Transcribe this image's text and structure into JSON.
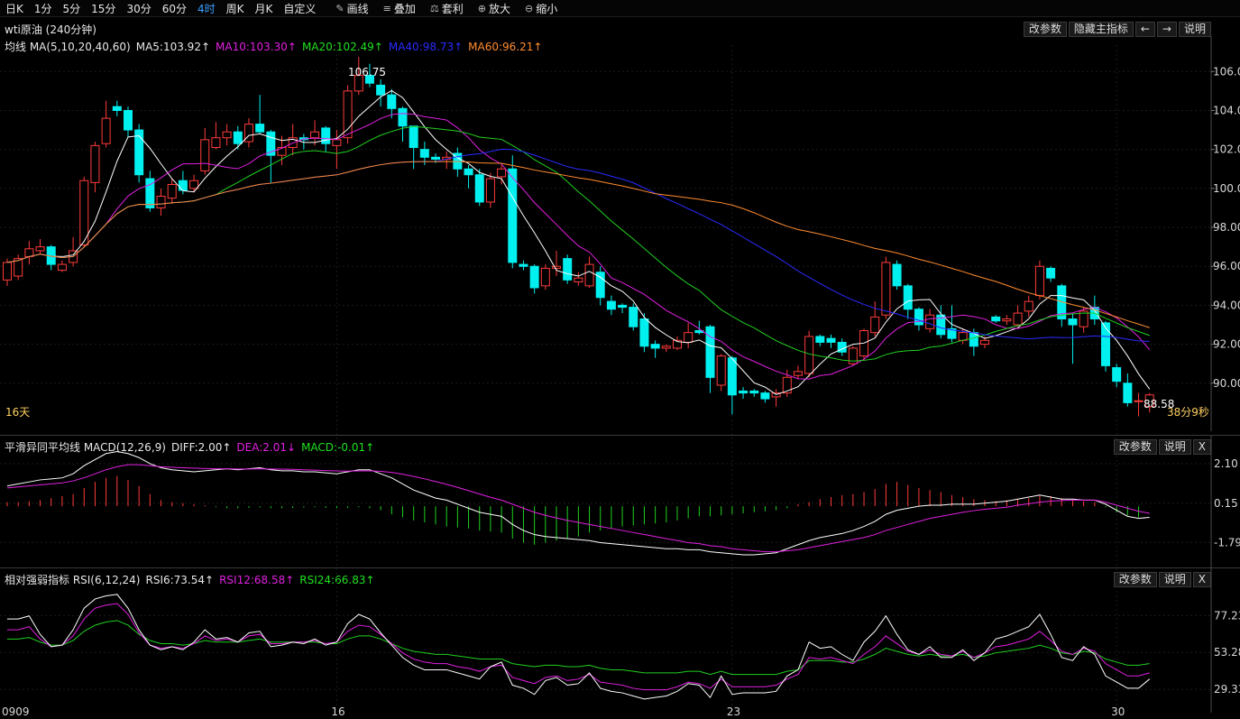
{
  "toolbar": {
    "periods": [
      {
        "label": "日K",
        "active": false
      },
      {
        "label": "1分",
        "active": false
      },
      {
        "label": "5分",
        "active": false
      },
      {
        "label": "15分",
        "active": false
      },
      {
        "label": "30分",
        "active": false
      },
      {
        "label": "60分",
        "active": false
      },
      {
        "label": "4时",
        "active": true
      },
      {
        "label": "周K",
        "active": false
      },
      {
        "label": "月K",
        "active": false
      },
      {
        "label": "自定义",
        "active": false
      }
    ],
    "tools": [
      {
        "label": "画线",
        "icon": "pencil-icon"
      },
      {
        "label": "叠加",
        "icon": "stack-icon"
      },
      {
        "label": "套利",
        "icon": "arbitrage-icon"
      },
      {
        "label": "放大",
        "icon": "zoom-in-icon"
      },
      {
        "label": "缩小",
        "icon": "zoom-out-icon"
      }
    ]
  },
  "main": {
    "title": "wti原油 (240分钟)",
    "buttons": [
      "改参数",
      "隐藏主指标",
      "←",
      "→",
      "说明"
    ],
    "ma_label": "均线 MA(5,10,20,40,60)",
    "ma_items": [
      {
        "text": "MA5:103.92↑",
        "color": "#e8e8e8"
      },
      {
        "text": "MA10:103.30↑",
        "color": "#e020e0"
      },
      {
        "text": "MA20:102.49↑",
        "color": "#20e020"
      },
      {
        "text": "MA40:98.73↑",
        "color": "#2a2aff"
      },
      {
        "text": "MA60:96.21↑",
        "color": "#ff8c30"
      }
    ],
    "high_label": "106.75",
    "last_price": "88.58",
    "countdown": "38分9秒",
    "range_label": "16天",
    "y_ticks": [
      "106.0",
      "104.0",
      "102.0",
      "100.0",
      "98.00",
      "96.00",
      "94.00",
      "92.00",
      "90.00"
    ]
  },
  "macd": {
    "label": "平滑异同平均线 MACD(12,26,9)",
    "items": [
      {
        "text": "DIFF:2.00↑",
        "color": "#e8e8e8"
      },
      {
        "text": "DEA:2.01↓",
        "color": "#e020e0"
      },
      {
        "text": "MACD:-0.01↑",
        "color": "#20e020"
      }
    ],
    "buttons": [
      "改参数",
      "说明",
      "X"
    ],
    "y_ticks": [
      "2.10",
      "0.15",
      "-1.79"
    ]
  },
  "rsi": {
    "label": "相对强弱指标 RSI(6,12,24)",
    "items": [
      {
        "text": "RSI6:73.54↑",
        "color": "#e8e8e8"
      },
      {
        "text": "RSI12:68.58↑",
        "color": "#e020e0"
      },
      {
        "text": "RSI24:66.83↑",
        "color": "#20e020"
      }
    ],
    "buttons": [
      "改参数",
      "说明",
      "X"
    ],
    "y_ticks": [
      "77.23",
      "53.28",
      "29.33"
    ]
  },
  "x_labels": [
    "0909",
    "16",
    "23",
    "30"
  ],
  "colors": {
    "up": "#ff3b3b",
    "down": "#00f0f0",
    "ma5": "#ffffff",
    "ma10": "#e020e0",
    "ma20": "#20d020",
    "ma40": "#2a2aff",
    "ma60": "#ff8c30"
  },
  "chart_data": {
    "type": "candlestick",
    "ylim": [
      88.0,
      106.8
    ],
    "candles": [
      [
        95.3,
        96.2,
        95.0,
        96.4
      ],
      [
        95.5,
        96.4,
        95.3,
        96.6
      ],
      [
        96.5,
        96.9,
        96.1,
        97.3
      ],
      [
        96.8,
        97.0,
        96.6,
        97.4
      ],
      [
        97.0,
        96.1,
        95.8,
        97.1
      ],
      [
        95.8,
        96.1,
        95.7,
        96.3
      ],
      [
        96.2,
        96.8,
        96.0,
        97.5
      ],
      [
        97.1,
        100.4,
        97.0,
        100.6
      ],
      [
        100.3,
        102.2,
        99.8,
        102.4
      ],
      [
        102.3,
        103.6,
        102.1,
        104.5
      ],
      [
        104.2,
        104.0,
        103.7,
        104.5
      ],
      [
        104.0,
        103.0,
        102.6,
        104.2
      ],
      [
        103.0,
        100.7,
        100.3,
        103.3
      ],
      [
        100.5,
        99.0,
        98.8,
        100.9
      ],
      [
        99.0,
        99.6,
        98.6,
        100.0
      ],
      [
        99.5,
        100.2,
        99.2,
        100.5
      ],
      [
        100.4,
        99.9,
        99.7,
        100.9
      ],
      [
        100.0,
        100.4,
        99.8,
        100.7
      ],
      [
        100.9,
        102.5,
        100.7,
        103.1
      ],
      [
        102.1,
        102.6,
        102.0,
        103.4
      ],
      [
        102.6,
        102.9,
        102.2,
        103.3
      ],
      [
        102.9,
        102.3,
        102.0,
        103.2
      ],
      [
        102.4,
        103.3,
        102.1,
        103.6
      ],
      [
        103.3,
        102.9,
        102.8,
        104.8
      ],
      [
        102.9,
        101.7,
        100.3,
        103.0
      ],
      [
        101.7,
        102.1,
        101.2,
        102.7
      ],
      [
        102.1,
        102.6,
        101.7,
        103.3
      ],
      [
        102.6,
        102.5,
        102.0,
        102.8
      ],
      [
        102.6,
        102.9,
        102.2,
        103.5
      ],
      [
        103.1,
        102.3,
        101.9,
        103.2
      ],
      [
        102.2,
        102.5,
        101.0,
        103.0
      ],
      [
        102.6,
        105.0,
        102.3,
        105.3
      ],
      [
        105.0,
        105.8,
        104.8,
        106.75
      ],
      [
        105.8,
        105.4,
        105.2,
        106.4
      ],
      [
        105.3,
        104.8,
        104.2,
        105.6
      ],
      [
        104.8,
        104.1,
        103.6,
        105.1
      ],
      [
        104.1,
        103.2,
        102.4,
        104.2
      ],
      [
        103.2,
        102.1,
        101.0,
        103.2
      ],
      [
        102.0,
        101.6,
        101.2,
        102.4
      ],
      [
        101.6,
        101.5,
        101.3,
        101.8
      ],
      [
        101.5,
        101.6,
        101.0,
        101.9
      ],
      [
        101.8,
        101.0,
        100.6,
        102.1
      ],
      [
        101.0,
        100.7,
        100.0,
        101.2
      ],
      [
        100.7,
        99.3,
        99.1,
        101.0
      ],
      [
        99.3,
        100.5,
        99.0,
        100.8
      ],
      [
        100.6,
        101.0,
        100.2,
        101.2
      ],
      [
        101.0,
        96.2,
        95.9,
        101.7
      ],
      [
        96.1,
        96.0,
        95.8,
        96.3
      ],
      [
        96.0,
        94.9,
        94.6,
        96.1
      ],
      [
        95.0,
        95.9,
        94.8,
        96.1
      ],
      [
        95.9,
        96.0,
        95.5,
        96.8
      ],
      [
        96.4,
        95.3,
        95.1,
        96.6
      ],
      [
        95.2,
        95.4,
        95.0,
        95.7
      ],
      [
        95.0,
        96.1,
        94.9,
        96.5
      ],
      [
        95.7,
        94.4,
        94.0,
        96.0
      ],
      [
        94.2,
        93.8,
        93.5,
        94.5
      ],
      [
        94.0,
        93.9,
        93.6,
        94.1
      ],
      [
        93.9,
        92.9,
        92.7,
        94.1
      ],
      [
        93.3,
        91.9,
        91.6,
        93.6
      ],
      [
        92.0,
        91.8,
        91.3,
        92.2
      ],
      [
        91.8,
        91.9,
        91.6,
        92.0
      ],
      [
        91.8,
        92.2,
        91.7,
        92.4
      ],
      [
        92.1,
        92.6,
        91.8,
        93.1
      ],
      [
        92.7,
        92.6,
        92.5,
        93.2
      ],
      [
        92.9,
        90.3,
        89.5,
        93.0
      ],
      [
        89.9,
        91.4,
        89.6,
        91.5
      ],
      [
        91.3,
        89.4,
        88.4,
        91.4
      ],
      [
        89.6,
        89.5,
        89.2,
        89.8
      ],
      [
        89.6,
        89.5,
        89.3,
        89.7
      ],
      [
        89.5,
        89.2,
        89.0,
        89.6
      ],
      [
        89.3,
        89.5,
        88.8,
        89.7
      ],
      [
        89.5,
        90.3,
        89.3,
        90.7
      ],
      [
        90.4,
        90.6,
        90.2,
        90.9
      ],
      [
        90.5,
        92.4,
        90.3,
        92.7
      ],
      [
        92.4,
        92.1,
        91.9,
        92.5
      ],
      [
        92.3,
        92.1,
        91.8,
        92.5
      ],
      [
        92.1,
        91.6,
        91.4,
        92.3
      ],
      [
        91.0,
        91.8,
        90.9,
        91.9
      ],
      [
        91.4,
        92.7,
        91.2,
        92.8
      ],
      [
        92.6,
        93.4,
        92.4,
        94.2
      ],
      [
        93.5,
        96.2,
        93.3,
        96.5
      ],
      [
        96.1,
        95.0,
        94.8,
        96.3
      ],
      [
        95.0,
        93.8,
        93.3,
        95.1
      ],
      [
        93.8,
        93.0,
        92.7,
        93.9
      ],
      [
        92.8,
        93.5,
        92.6,
        93.8
      ],
      [
        93.5,
        92.5,
        92.3,
        94.0
      ],
      [
        92.8,
        92.3,
        92.1,
        94.0
      ],
      [
        92.2,
        92.6,
        92.0,
        92.8
      ],
      [
        92.6,
        91.9,
        91.4,
        92.8
      ],
      [
        92.0,
        92.2,
        91.8,
        92.4
      ],
      [
        93.4,
        93.2,
        93.1,
        93.5
      ],
      [
        93.2,
        93.3,
        93.0,
        93.5
      ],
      [
        93.0,
        93.6,
        92.9,
        94.0
      ],
      [
        93.7,
        94.2,
        93.4,
        94.5
      ],
      [
        94.5,
        96.0,
        94.3,
        96.3
      ],
      [
        95.9,
        95.4,
        95.2,
        96.0
      ],
      [
        95.0,
        93.3,
        92.9,
        95.1
      ],
      [
        93.3,
        93.0,
        91.0,
        93.6
      ],
      [
        92.9,
        93.7,
        92.6,
        93.9
      ],
      [
        93.9,
        93.3,
        93.0,
        94.5
      ],
      [
        93.1,
        90.9,
        90.6,
        93.2
      ],
      [
        90.8,
        90.1,
        89.8,
        91.0
      ],
      [
        90.0,
        89.0,
        88.8,
        90.5
      ],
      [
        89.1,
        89.1,
        88.3,
        89.5
      ],
      [
        88.8,
        89.4,
        88.5,
        89.5
      ]
    ],
    "macd_ylim": [
      -2.4,
      2.5
    ],
    "macd_hist": [
      0.2,
      0.2,
      0.25,
      0.3,
      0.4,
      0.5,
      0.6,
      0.9,
      1.2,
      1.4,
      1.5,
      1.3,
      1.0,
      0.6,
      0.3,
      0.2,
      0.15,
      0.1,
      0.05,
      -0.05,
      -0.1,
      -0.1,
      -0.08,
      -0.06,
      -0.1,
      -0.1,
      -0.09,
      -0.06,
      -0.05,
      -0.08,
      -0.1,
      -0.08,
      -0.05,
      -0.1,
      -0.2,
      -0.4,
      -0.55,
      -0.7,
      -0.8,
      -0.9,
      -1.0,
      -1.05,
      -1.1,
      -1.2,
      -1.25,
      -1.3,
      -1.6,
      -1.8,
      -1.9,
      -1.8,
      -1.7,
      -1.6,
      -1.5,
      -1.3,
      -1.2,
      -1.1,
      -1.0,
      -0.95,
      -0.9,
      -0.85,
      -0.8,
      -0.7,
      -0.6,
      -0.5,
      -0.5,
      -0.45,
      -0.4,
      -0.35,
      -0.3,
      -0.25,
      -0.2,
      -0.1,
      0.1,
      0.2,
      0.35,
      0.45,
      0.55,
      0.6,
      0.7,
      0.85,
      1.1,
      1.2,
      1.05,
      0.9,
      0.8,
      0.7,
      0.55,
      0.45,
      0.35,
      0.3,
      0.25,
      0.3,
      0.35,
      0.4,
      0.55,
      0.5,
      0.4,
      0.3,
      0.25,
      0.2,
      -0.05,
      -0.3,
      -0.45,
      -0.55,
      -0.01
    ],
    "diff": [
      1.0,
      1.1,
      1.2,
      1.3,
      1.35,
      1.4,
      1.6,
      2.0,
      2.3,
      2.6,
      2.7,
      2.6,
      2.4,
      2.1,
      1.9,
      1.8,
      1.75,
      1.7,
      1.75,
      1.8,
      1.85,
      1.8,
      1.85,
      1.9,
      1.8,
      1.75,
      1.75,
      1.7,
      1.7,
      1.65,
      1.6,
      1.7,
      1.8,
      1.8,
      1.6,
      1.4,
      1.1,
      0.8,
      0.6,
      0.4,
      0.3,
      0.1,
      -0.1,
      -0.3,
      -0.4,
      -0.5,
      -0.9,
      -1.2,
      -1.4,
      -1.5,
      -1.55,
      -1.6,
      -1.65,
      -1.7,
      -1.8,
      -1.85,
      -1.9,
      -1.95,
      -2.0,
      -2.05,
      -2.1,
      -2.1,
      -2.15,
      -2.15,
      -2.25,
      -2.3,
      -2.35,
      -2.4,
      -2.4,
      -2.35,
      -2.3,
      -2.1,
      -1.9,
      -1.7,
      -1.55,
      -1.45,
      -1.35,
      -1.2,
      -1.0,
      -0.75,
      -0.4,
      -0.2,
      -0.1,
      0.0,
      0.05,
      0.05,
      0.1,
      0.1,
      0.1,
      0.15,
      0.2,
      0.25,
      0.35,
      0.45,
      0.55,
      0.45,
      0.35,
      0.35,
      0.3,
      0.3,
      0.1,
      -0.2,
      -0.5,
      -0.6,
      -0.55
    ],
    "dea": [
      0.9,
      0.95,
      1.0,
      1.05,
      1.1,
      1.15,
      1.25,
      1.4,
      1.6,
      1.8,
      1.95,
      2.05,
      2.05,
      2.0,
      1.95,
      1.92,
      1.9,
      1.88,
      1.86,
      1.85,
      1.85,
      1.84,
      1.84,
      1.85,
      1.84,
      1.83,
      1.82,
      1.8,
      1.78,
      1.76,
      1.74,
      1.73,
      1.74,
      1.75,
      1.72,
      1.67,
      1.58,
      1.47,
      1.35,
      1.22,
      1.08,
      0.93,
      0.77,
      0.6,
      0.44,
      0.3,
      0.1,
      -0.1,
      -0.3,
      -0.45,
      -0.58,
      -0.7,
      -0.8,
      -0.9,
      -1.0,
      -1.1,
      -1.2,
      -1.3,
      -1.4,
      -1.5,
      -1.6,
      -1.7,
      -1.8,
      -1.85,
      -1.95,
      -2.0,
      -2.1,
      -2.15,
      -2.2,
      -2.25,
      -2.25,
      -2.2,
      -2.15,
      -2.05,
      -1.95,
      -1.85,
      -1.75,
      -1.65,
      -1.55,
      -1.4,
      -1.2,
      -1.05,
      -0.9,
      -0.75,
      -0.6,
      -0.5,
      -0.4,
      -0.3,
      -0.22,
      -0.15,
      -0.1,
      -0.05,
      0.05,
      0.12,
      0.2,
      0.25,
      0.28,
      0.3,
      0.3,
      0.3,
      0.2,
      0.05,
      -0.1,
      -0.25,
      -0.35
    ],
    "rsi_ylim": [
      20,
      95
    ],
    "rsi6": [
      75,
      75,
      77,
      65,
      57,
      58,
      68,
      82,
      88,
      90,
      91,
      82,
      68,
      58,
      55,
      57,
      55,
      60,
      68,
      62,
      63,
      60,
      66,
      67,
      57,
      58,
      60,
      59,
      62,
      58,
      60,
      72,
      78,
      75,
      66,
      58,
      50,
      45,
      42,
      42,
      42,
      40,
      38,
      36,
      44,
      47,
      32,
      30,
      26,
      35,
      37,
      32,
      33,
      40,
      30,
      28,
      27,
      25,
      23,
      24,
      25,
      28,
      33,
      32,
      24,
      38,
      26,
      27,
      27,
      27,
      28,
      38,
      42,
      60,
      56,
      57,
      52,
      48,
      60,
      67,
      77,
      65,
      55,
      52,
      57,
      50,
      50,
      55,
      48,
      53,
      62,
      64,
      67,
      70,
      78,
      65,
      50,
      48,
      57,
      52,
      38,
      34,
      30,
      30,
      36
    ],
    "rsi12": [
      68,
      68,
      70,
      62,
      57,
      58,
      64,
      75,
      82,
      84,
      85,
      78,
      66,
      58,
      56,
      57,
      56,
      59,
      64,
      61,
      62,
      60,
      64,
      65,
      59,
      59,
      60,
      60,
      61,
      59,
      60,
      67,
      71,
      70,
      65,
      59,
      53,
      49,
      47,
      46,
      46,
      44,
      43,
      41,
      44,
      45,
      37,
      35,
      33,
      37,
      38,
      35,
      36,
      39,
      34,
      33,
      32,
      30,
      29,
      29,
      29,
      31,
      34,
      33,
      30,
      36,
      31,
      31,
      31,
      31,
      32,
      36,
      39,
      50,
      49,
      50,
      48,
      46,
      52,
      57,
      64,
      59,
      54,
      52,
      55,
      52,
      51,
      54,
      50,
      53,
      57,
      58,
      60,
      62,
      67,
      61,
      54,
      52,
      56,
      54,
      46,
      42,
      38,
      38,
      40
    ],
    "rsi24": [
      62,
      62,
      63,
      60,
      58,
      58,
      61,
      67,
      71,
      73,
      74,
      71,
      65,
      61,
      59,
      59,
      58,
      59,
      61,
      60,
      60,
      60,
      61,
      62,
      60,
      60,
      60,
      60,
      60,
      59,
      59,
      62,
      64,
      64,
      62,
      59,
      56,
      54,
      53,
      52,
      52,
      51,
      50,
      49,
      49,
      49,
      46,
      45,
      44,
      45,
      45,
      44,
      44,
      45,
      43,
      42,
      42,
      41,
      40,
      40,
      40,
      40,
      41,
      41,
      39,
      41,
      39,
      39,
      39,
      39,
      39,
      41,
      42,
      48,
      48,
      48,
      47,
      47,
      49,
      52,
      56,
      54,
      52,
      51,
      52,
      51,
      51,
      52,
      50,
      51,
      53,
      54,
      55,
      56,
      58,
      56,
      53,
      52,
      54,
      53,
      49,
      47,
      45,
      45,
      46
    ]
  }
}
